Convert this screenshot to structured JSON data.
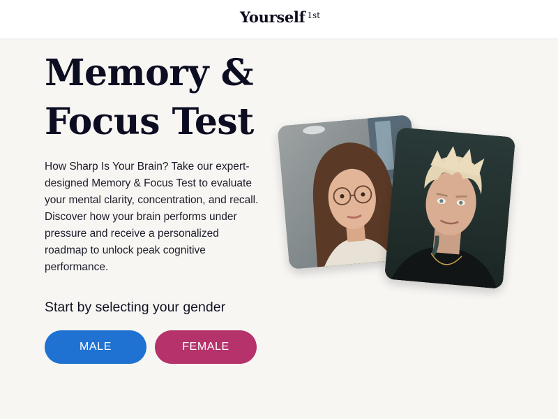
{
  "header": {
    "logo_text": "Yourself",
    "logo_superscript": "1st"
  },
  "hero": {
    "title": "Memory & Focus Test",
    "description": "How Sharp Is Your Brain? Take our expert-designed Memory & Focus Test to evaluate your mental clarity, concentration, and recall. Discover how your brain performs under pressure and receive a personalized roadmap to unlock peak cognitive performance.",
    "gender_prompt": "Start by selecting your gender",
    "buttons": {
      "male": "MALE",
      "female": "FEMALE"
    }
  },
  "colors": {
    "background": "#f8f6f3",
    "male_button": "#1f72d1",
    "female_button": "#b5336a",
    "heading": "#0d0d22"
  }
}
